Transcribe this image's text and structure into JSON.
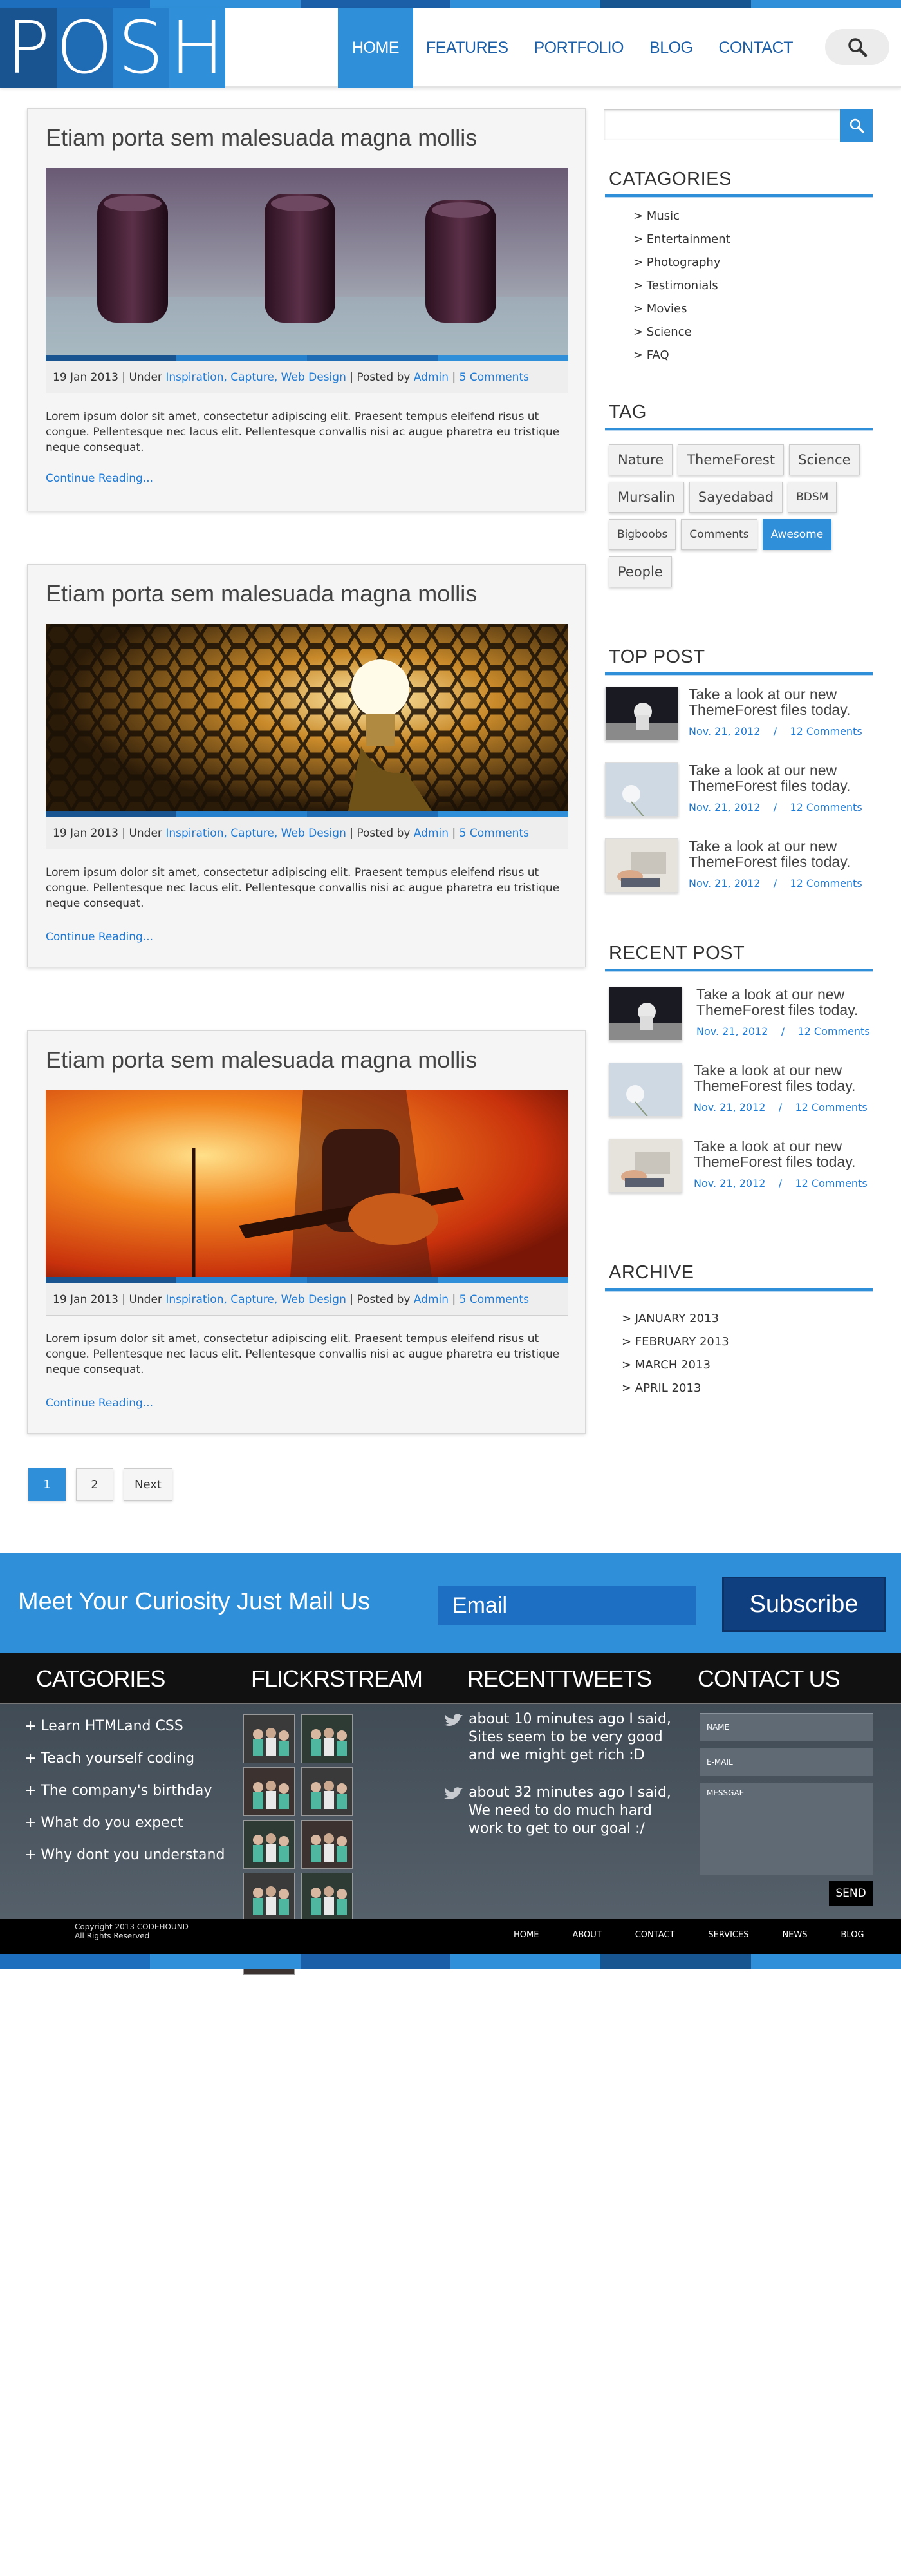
{
  "colors": {
    "accent": "#2f8fd8",
    "accent_dark": "#0f3f7e",
    "strip": [
      "#1d6fbe",
      "#2f8fd8",
      "#1b5fa8",
      "#2f8fd8",
      "#16558f",
      "#2f8fd8"
    ]
  },
  "logo": {
    "letters": [
      "P",
      "O",
      "S",
      "H"
    ],
    "colors": [
      "#1a5490",
      "#1f6cb5",
      "#2680cc",
      "#2f8fd8"
    ]
  },
  "nav": {
    "items": [
      "HOME",
      "FEATURES",
      "PORTFOLIO",
      "BLOG",
      "CONTACT"
    ],
    "active": "HOME"
  },
  "header": {
    "search_icon": "search-icon"
  },
  "posts": [
    {
      "title": "Etiam porta sem malesuada magna mollis",
      "image": "studio-knobs",
      "date": "19 Jan 2013",
      "under_label": "Under",
      "categories": "Inspiration, Capture, Web Design",
      "posted_by_label": "Posted by",
      "author": "Admin",
      "comments": "5 Comments",
      "excerpt": "Lorem ipsum dolor sit amet, consectetur adipiscing elit. Praesent tempus eleifend risus ut congue. Pellentesque nec lacus elit. Pellentesque convallis nisi ac augue pharetra eu tristique neque consequat.",
      "more": "Continue Reading..."
    },
    {
      "title": "Etiam porta sem malesuada magna mollis",
      "image": "light-bulb",
      "date": "19 Jan 2013",
      "under_label": "Under",
      "categories": "Inspiration, Capture, Web Design",
      "posted_by_label": "Posted by",
      "author": "Admin",
      "comments": "5 Comments",
      "excerpt": "Lorem ipsum dolor sit amet, consectetur adipiscing elit. Praesent tempus eleifend risus ut congue. Pellentesque nec lacus elit. Pellentesque convallis nisi ac augue pharetra eu tristique neque consequat.",
      "more": "Continue Reading..."
    },
    {
      "title": "Etiam porta sem malesuada magna mollis",
      "image": "guitarist-stage",
      "date": "19 Jan 2013",
      "under_label": "Under",
      "categories": "Inspiration, Capture, Web Design",
      "posted_by_label": "Posted by",
      "author": "Admin",
      "comments": "5 Comments",
      "excerpt": "Lorem ipsum dolor sit amet, consectetur adipiscing elit. Praesent tempus eleifend risus ut congue. Pellentesque nec lacus elit. Pellentesque convallis nisi ac augue pharetra eu tristique neque consequat.",
      "more": "Continue Reading..."
    }
  ],
  "pagination": {
    "pages": [
      "1",
      "2"
    ],
    "active": "1",
    "next": "Next"
  },
  "sidebar": {
    "search": {
      "placeholder": "",
      "icon": "search-icon"
    },
    "categories": {
      "title": "CATAGORIES",
      "items": [
        "> Music",
        "> Entertainment",
        "> Photography",
        "> Testimonials",
        "> Movies",
        "> Science",
        "> FAQ"
      ]
    },
    "tags": {
      "title": "TAG",
      "items": [
        "Nature",
        "ThemeForest",
        "Science",
        "Mursalin",
        "Sayedabad",
        "BDSM",
        "Bigboobs",
        "Comments",
        "Awesome",
        "People"
      ],
      "small": [
        "BDSM",
        "Bigboobs",
        "Comments",
        "Awesome"
      ],
      "active": "Awesome"
    },
    "top_post": {
      "title": "TOP POST",
      "items": [
        {
          "text": "Take a look at our new ThemeForest files today.",
          "date": "Nov. 21, 2012",
          "sep": "/",
          "comments": "12 Comments",
          "thumb": "astronaut"
        },
        {
          "text": "Take a look at our new ThemeForest files today.",
          "date": "Nov. 21, 2012",
          "sep": "/",
          "comments": "12 Comments",
          "thumb": "dandelion"
        },
        {
          "text": "Take a look at our new ThemeForest files today.",
          "date": "Nov. 21, 2012",
          "sep": "/",
          "comments": "12 Comments",
          "thumb": "laptop-hands"
        }
      ]
    },
    "recent_post": {
      "title": "RECENT POST",
      "items": [
        {
          "text": "Take a look at our new ThemeForest files today.",
          "date": "Nov. 21, 2012",
          "sep": "/",
          "comments": "12 Comments",
          "thumb": "astronaut"
        },
        {
          "text": "Take a look at our new ThemeForest files today.",
          "date": "Nov. 21, 2012",
          "sep": "/",
          "comments": "12 Comments",
          "thumb": "dandelion"
        },
        {
          "text": "Take a look at our new ThemeForest files today.",
          "date": "Nov. 21, 2012",
          "sep": "/",
          "comments": "12 Comments",
          "thumb": "laptop-hands"
        }
      ]
    },
    "archive": {
      "title": "ARCHIVE",
      "items": [
        "> JANUARY 2013",
        "> FEBRUARY 2013",
        "> MARCH 2013",
        "> APRIL 2013"
      ]
    }
  },
  "subscribe": {
    "text": "Meet Your Curiosity Just Mail Us",
    "placeholder": "Email",
    "button": "Subscribe"
  },
  "footer": {
    "categories": {
      "title": "CATGORIES",
      "items": [
        "+ Learn HTMLand CSS",
        "+ Teach yourself coding",
        "+ The company's birthday",
        "+ What do you expect",
        "+ Why dont you understand"
      ]
    },
    "flickr": {
      "title": "FLICKRSTREAM",
      "photo_count": 9
    },
    "tweets": {
      "title": "RECENTTWEETS",
      "items": [
        "about 10 minutes ago I said, Sites seem to be very good and we might get rich :D",
        "about 32 minutes ago I said, We need to do much hard work to get to our goal :/"
      ],
      "icon": "twitter-bird-icon"
    },
    "contact": {
      "title": "CONTACT US",
      "name_placeholder": "NAME",
      "email_placeholder": "E-MAIL",
      "message_placeholder": "MESSGAE",
      "send": "SEND"
    },
    "copyright_line1": "Copyright 2013 CODEHOUND",
    "copyright_line2": "All Rights Reserved",
    "nav": [
      "HOME",
      "ABOUT",
      "CONTACT",
      "SERVICES",
      "NEWS",
      "BLOG"
    ]
  }
}
